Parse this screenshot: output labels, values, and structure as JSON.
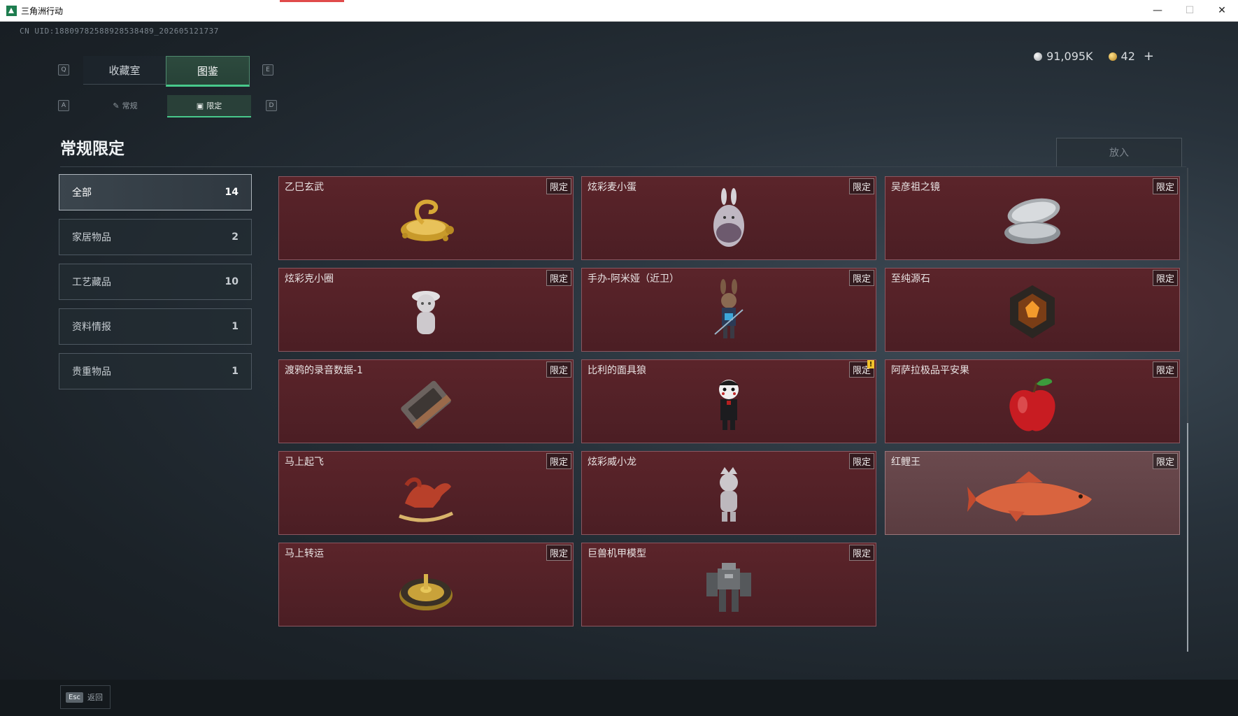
{
  "window": {
    "title": "三角洲行动",
    "minimize": "—",
    "maximize": "☐",
    "close": "✕"
  },
  "uid": "CN UID:18809782588928538489_202605121737",
  "currency": {
    "silver": "91,095K",
    "gold": "42",
    "plus": "+"
  },
  "keys": {
    "q": "Q",
    "e": "E",
    "a": "A",
    "d": "D"
  },
  "tabs": [
    {
      "label": "收藏室",
      "active": false
    },
    {
      "label": "图鉴",
      "active": true
    }
  ],
  "subtabs": [
    {
      "label": "常规",
      "icon": "pin-icon",
      "active": false
    },
    {
      "label": "限定",
      "icon": "image-icon",
      "active": true
    }
  ],
  "section_title": "常规限定",
  "place_button": "放入",
  "categories": [
    {
      "label": "全部",
      "count": "14",
      "active": true
    },
    {
      "label": "家居物品",
      "count": "2"
    },
    {
      "label": "工艺藏品",
      "count": "10"
    },
    {
      "label": "资料情报",
      "count": "1"
    },
    {
      "label": "贵重物品",
      "count": "1"
    }
  ],
  "items": [
    {
      "name": "乙巳玄武",
      "tag": "限定",
      "icon": "golden-tortoise-snake-icon"
    },
    {
      "name": "炫彩麦小蛋",
      "tag": "限定",
      "icon": "bunny-egg-figure-icon"
    },
    {
      "name": "吴彦祖之镜",
      "tag": "限定",
      "icon": "compact-mirror-icon"
    },
    {
      "name": "炫彩克小圈",
      "tag": "限定",
      "icon": "white-figurine-icon"
    },
    {
      "name": "手办-阿米娅（近卫）",
      "tag": "限定",
      "icon": "amiya-figure-icon"
    },
    {
      "name": "至纯源石",
      "tag": "限定",
      "icon": "originium-crystal-icon"
    },
    {
      "name": "渡鸦的录音数据-1",
      "tag": "限定",
      "icon": "cassette-tape-icon"
    },
    {
      "name": "比利的面具狼",
      "tag": "限定",
      "icon": "billy-puppet-icon",
      "alert": "!"
    },
    {
      "name": "阿萨拉极品平安果",
      "tag": "限定",
      "icon": "red-apple-icon"
    },
    {
      "name": "马上起飞",
      "tag": "限定",
      "icon": "rocking-horse-icon"
    },
    {
      "name": "炫彩威小龙",
      "tag": "限定",
      "icon": "dragon-figurine-icon"
    },
    {
      "name": "红鲤王",
      "tag": "限定",
      "icon": "red-carp-icon",
      "highlight": true
    },
    {
      "name": "马上转运",
      "tag": "限定",
      "icon": "fortune-wheel-icon"
    },
    {
      "name": "巨兽机甲模型",
      "tag": "限定",
      "icon": "mech-model-icon"
    }
  ],
  "footer": {
    "esc_key": "Esc",
    "esc_label": "返回"
  },
  "colors": {
    "accent": "#48c98b",
    "card_bg": "#5b242a",
    "card_border": "#8a5760"
  }
}
